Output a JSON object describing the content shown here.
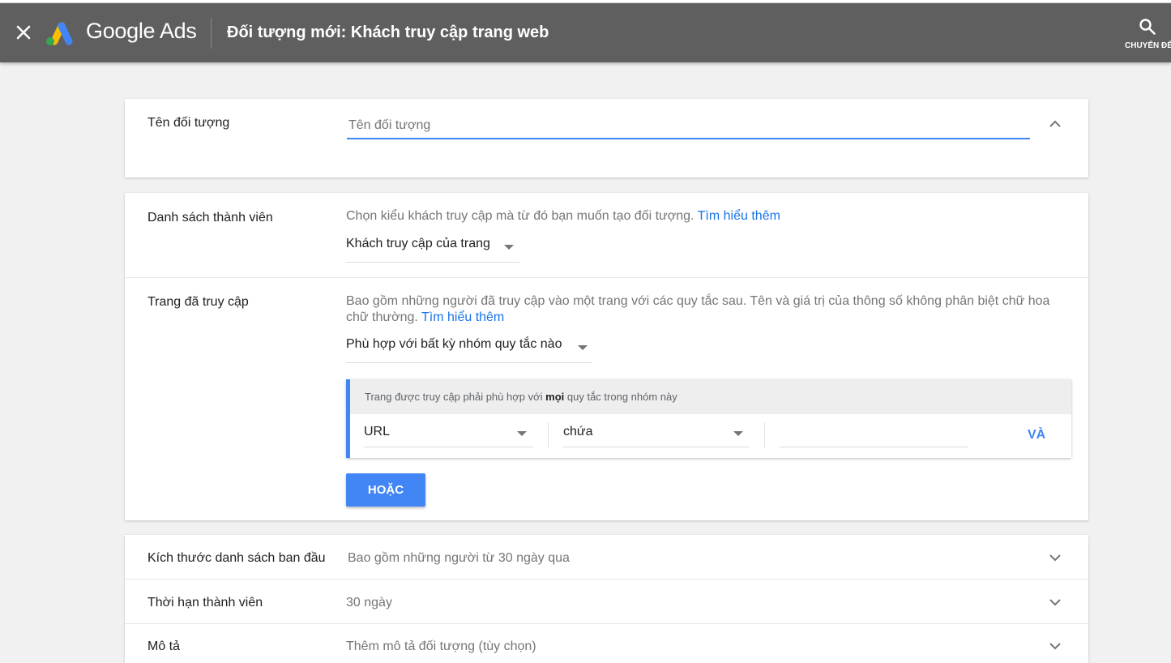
{
  "header": {
    "brand": "Google Ads",
    "title": "Đối tượng mới: Khách truy cập trang web",
    "goto_label": "CHUYỂN ĐẾN"
  },
  "name_section": {
    "label": "Tên đối tượng",
    "placeholder": "Tên đối tượng"
  },
  "members_section": {
    "label": "Danh sách thành viên",
    "description": "Chọn kiểu khách truy cập mà từ đó bạn muốn tạo đối tượng.",
    "learn_more": "Tìm hiểu thêm",
    "selected": "Khách truy cập của trang"
  },
  "visited_section": {
    "label": "Trang đã truy cập",
    "description": "Bao gồm những người đã truy cập vào một trang với các quy tắc sau. Tên và giá trị của thông số không phân biệt chữ hoa chữ thường.",
    "learn_more": "Tìm hiểu thêm",
    "match_selected": "Phù hợp với bất kỳ nhóm quy tắc nào",
    "rule_group": {
      "header_before": "Trang được truy cập phải phù hợp với",
      "header_bold": "mọi",
      "header_after": "quy tắc trong nhóm này",
      "field": "URL",
      "operator": "chứa",
      "value": "",
      "and_label": "VÀ"
    },
    "or_label": "HOẶC"
  },
  "settings": {
    "initial_size": {
      "label": "Kích thước danh sách ban đầu",
      "value": "Bao gồm những người từ 30 ngày qua"
    },
    "duration": {
      "label": "Thời hạn thành viên",
      "value": "30 ngày"
    },
    "description": {
      "label": "Mô tả",
      "value": "Thêm mô tả đối tượng (tùy chọn)"
    }
  },
  "colors": {
    "header_bg": "#5f5f5f",
    "accent": "#4285f4",
    "link": "#1a73e8"
  },
  "icons": [
    "close-icon",
    "google-ads-logo",
    "search-icon",
    "chevron-up-icon",
    "chevron-down-icon",
    "dropdown-caret-icon"
  ]
}
